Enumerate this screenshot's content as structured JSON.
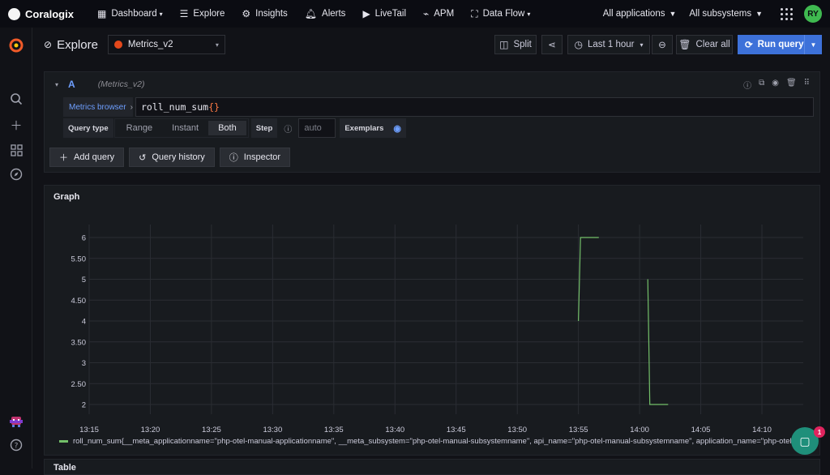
{
  "topnav": {
    "brand": "Coralogix",
    "items": [
      {
        "icon": "dashboard-grid-icon",
        "label": "Dashboard",
        "has_dropdown": true
      },
      {
        "icon": "explore-list-icon",
        "label": "Explore",
        "has_dropdown": false
      },
      {
        "icon": "insights-gear-icon",
        "label": "Insights",
        "has_dropdown": false
      },
      {
        "icon": "bell-icon",
        "label": "Alerts",
        "has_dropdown": false
      },
      {
        "icon": "play-icon",
        "label": "LiveTail",
        "has_dropdown": false
      },
      {
        "icon": "apm-icon",
        "label": "APM",
        "has_dropdown": false
      },
      {
        "icon": "data-flow-icon",
        "label": "Data Flow",
        "has_dropdown": true
      }
    ],
    "applications": "All applications",
    "subsystems": "All subsystems",
    "avatar_initials": "RY"
  },
  "header": {
    "title": "Explore",
    "datasource": "Metrics_v2",
    "split_label": "Split",
    "time_range": "Last 1 hour",
    "clear_label": "Clear all",
    "run_label": "Run query"
  },
  "query": {
    "ref_id": "A",
    "datasource": "(Metrics_v2)",
    "metrics_browser": "Metrics browser",
    "expression_name": "roll_num_sum",
    "expression_braces": "{}",
    "query_type_label": "Query type",
    "query_types": [
      "Range",
      "Instant",
      "Both"
    ],
    "query_type_selected": "Both",
    "step_label": "Step",
    "step_placeholder": "auto",
    "exemplars_label": "Exemplars",
    "add_query": "Add query",
    "query_history": "Query history",
    "inspector": "Inspector"
  },
  "graph": {
    "title": "Graph",
    "series_color": "#73bf69",
    "legend": "roll_num_sum{__meta_applicationname=\"php-otel-manual-applicationname\", __meta_subsystem=\"php-otel-manual-subsystemname\", api_name=\"php-otel-manual-subsystemname\", application_name=\"php-otel-manual-applica"
  },
  "chart_data": {
    "type": "line",
    "title": "Graph",
    "xlabel": "",
    "ylabel": "",
    "x_ticks": [
      "13:15",
      "13:20",
      "13:25",
      "13:30",
      "13:35",
      "13:40",
      "13:45",
      "13:50",
      "13:55",
      "14:00",
      "14:05",
      "14:10"
    ],
    "y_ticks": [
      "2",
      "2.50",
      "3",
      "3.50",
      "4",
      "4.50",
      "5",
      "5.50",
      "6"
    ],
    "ylim": [
      2,
      6
    ],
    "grid": true,
    "legend_position": "bottom",
    "series": [
      {
        "name": "roll_num_sum{__meta_applicationname=\"php-otel-manual-applicationname\", __meta_subsystem=\"php-otel-manual-subsystemname\", api_name=\"php-otel-manual-subsystemname\", application_name=\"php-otel-manual-applica",
        "segments": [
          [
            {
              "x": "13:55:00",
              "y": 4
            },
            {
              "x": "13:55:10",
              "y": 6
            },
            {
              "x": "13:56:40",
              "y": 6
            }
          ],
          [
            {
              "x": "14:00:40",
              "y": 5
            },
            {
              "x": "14:00:50",
              "y": 2
            },
            {
              "x": "14:02:20",
              "y": 2
            }
          ]
        ]
      }
    ]
  },
  "table": {
    "title": "Table"
  },
  "chat": {
    "badge": "1"
  }
}
